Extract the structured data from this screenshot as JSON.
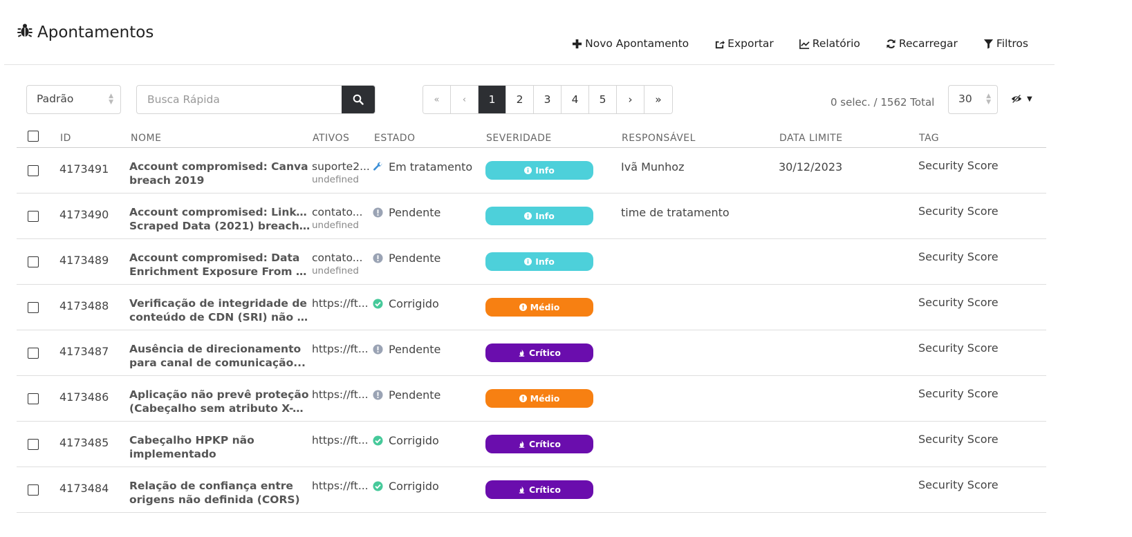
{
  "page": {
    "title": "Apontamentos",
    "title_icon": "bug-icon"
  },
  "actions": [
    {
      "icon": "plus-icon",
      "label": "Novo Apontamento"
    },
    {
      "icon": "export-icon",
      "label": "Exportar"
    },
    {
      "icon": "chart-icon",
      "label": "Relatório"
    },
    {
      "icon": "refresh-icon",
      "label": "Recarregar"
    },
    {
      "icon": "filter-icon",
      "label": "Filtros"
    }
  ],
  "toolbar": {
    "view_select": "Padrão",
    "search_placeholder": "Busca Rápida",
    "pagination": {
      "first": "«",
      "prev": "‹",
      "pages": [
        "1",
        "2",
        "3",
        "4",
        "5"
      ],
      "active": "1",
      "next": "›",
      "last": "»"
    },
    "selection_total": "0 selec. / 1562 Total",
    "per_page": "30"
  },
  "table": {
    "headers": {
      "id": "ID",
      "name": "NOME",
      "assets": "ATIVOS",
      "state": "ESTADO",
      "severity": "SEVERIDADE",
      "responsible": "RESPONSÁVEL",
      "deadline": "DATA LIMITE",
      "tag": "TAG"
    },
    "rows": [
      {
        "id": "4173491",
        "name1": "Account compromised: Canva",
        "name2": "breach 2019",
        "asset": "suporte2...",
        "asset_sub": "undefined",
        "state": "Em tratamento",
        "state_icon": "wrench-icon",
        "severity": "Info",
        "responsible": "Ivã Munhoz",
        "deadline": "30/12/2023",
        "tag": "Security Score"
      },
      {
        "id": "4173490",
        "name1": "Account compromised: LinkedIn",
        "name2": "Scraped Data (2021) breach...",
        "asset": "contato...",
        "asset_sub": "undefined",
        "state": "Pendente",
        "state_icon": "exclamation-circle-icon",
        "severity": "Info",
        "responsible": "time de tratamento",
        "deadline": "",
        "tag": "Security Score"
      },
      {
        "id": "4173489",
        "name1": "Account compromised: Data",
        "name2": "Enrichment Exposure From PD...",
        "asset": "contato...",
        "asset_sub": "undefined",
        "state": "Pendente",
        "state_icon": "exclamation-circle-icon",
        "severity": "Info",
        "responsible": "",
        "deadline": "",
        "tag": "Security Score"
      },
      {
        "id": "4173488",
        "name1": "Verificação de integridade de",
        "name2": "conteúdo de CDN (SRI) não est...",
        "asset": "https://ft...",
        "asset_sub": "",
        "state": "Corrigido",
        "state_icon": "check-circle-icon",
        "severity": "Médio",
        "responsible": "",
        "deadline": "",
        "tag": "Security Score"
      },
      {
        "id": "4173487",
        "name1": "Ausência de direcionamento",
        "name2": "para canal de comunicação...",
        "asset": "https://ft...",
        "asset_sub": "",
        "state": "Pendente",
        "state_icon": "exclamation-circle-icon",
        "severity": "Crítico",
        "responsible": "",
        "deadline": "",
        "tag": "Security Score"
      },
      {
        "id": "4173486",
        "name1": "Aplicação não prevê proteção",
        "name2": "(Cabeçalho sem atributo X-XSS...",
        "asset": "https://ft...",
        "asset_sub": "",
        "state": "Pendente",
        "state_icon": "exclamation-circle-icon",
        "severity": "Médio",
        "responsible": "",
        "deadline": "",
        "tag": "Security Score"
      },
      {
        "id": "4173485",
        "name1": "Cabeçalho HPKP não",
        "name2": "implementado",
        "asset": "https://ft...",
        "asset_sub": "",
        "state": "Corrigido",
        "state_icon": "check-circle-icon",
        "severity": "Crítico",
        "responsible": "",
        "deadline": "",
        "tag": "Security Score"
      },
      {
        "id": "4173484",
        "name1": "Relação de confiança entre",
        "name2": "origens não definida (CORS)",
        "asset": "https://ft...",
        "asset_sub": "",
        "state": "Corrigido",
        "state_icon": "check-circle-icon",
        "severity": "Crítico",
        "responsible": "",
        "deadline": "",
        "tag": "Security Score"
      }
    ]
  },
  "colors": {
    "Info": "#4dd0da",
    "Médio": "#f78012",
    "Crítico": "#6a0dad",
    "dark": "#2d2f33",
    "state_wrench": "#3b8fd6",
    "state_pending": "#9aa3b4",
    "state_check": "#46c99a"
  }
}
